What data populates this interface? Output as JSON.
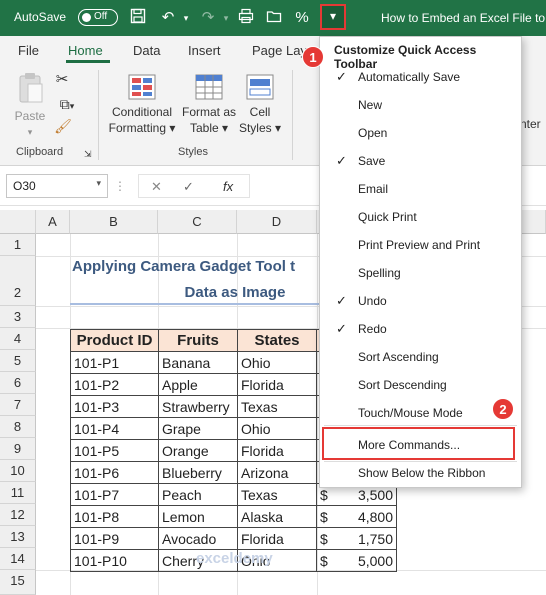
{
  "titlebar": {
    "autosave_label": "AutoSave",
    "autosave_state": "Off",
    "doc_title": "How to Embed an Excel File to I"
  },
  "tabs": [
    "File",
    "Home",
    "Data",
    "Insert",
    "Page Lay"
  ],
  "ribbon": {
    "clipboard": {
      "paste": "Paste",
      "group": "Clipboard"
    },
    "styles": {
      "conditional": [
        "Conditional",
        "Formatting ▾"
      ],
      "format_table": [
        "Format as",
        "Table ▾"
      ],
      "cell_styles": [
        "Cell",
        "Styles ▾"
      ],
      "group": "Styles"
    },
    "partial_right": "nter"
  },
  "formula_bar": {
    "name_box": "O30",
    "fx": "fx"
  },
  "columns": [
    "A",
    "B",
    "C",
    "D"
  ],
  "rows": [
    "1",
    "2",
    "3",
    "4",
    "5",
    "6",
    "7",
    "8",
    "9",
    "10",
    "11",
    "12",
    "13",
    "14",
    "15"
  ],
  "sheet": {
    "title_line1": "Applying Camera Gadget Tool t",
    "title_line2": "Data as Image",
    "headers": [
      "Product ID",
      "Fruits",
      "States"
    ],
    "table": [
      {
        "id": "101-P1",
        "fruit": "Banana",
        "state": "Ohio",
        "amount": ""
      },
      {
        "id": "101-P2",
        "fruit": "Apple",
        "state": "Florida",
        "amount": ""
      },
      {
        "id": "101-P3",
        "fruit": "Strawberry",
        "state": "Texas",
        "amount": ""
      },
      {
        "id": "101-P4",
        "fruit": "Grape",
        "state": "Ohio",
        "amount": ""
      },
      {
        "id": "101-P5",
        "fruit": "Orange",
        "state": "Florida",
        "amount": ""
      },
      {
        "id": "101-P6",
        "fruit": "Blueberry",
        "state": "Arizona",
        "amount": ""
      },
      {
        "id": "101-P7",
        "fruit": "Peach",
        "state": "Texas",
        "amount": "3,500"
      },
      {
        "id": "101-P8",
        "fruit": "Lemon",
        "state": "Alaska",
        "amount": "4,800"
      },
      {
        "id": "101-P9",
        "fruit": "Avocado",
        "state": "Florida",
        "amount": "1,750"
      },
      {
        "id": "101-P10",
        "fruit": "Cherry",
        "state": "Ohio",
        "amount": "5,000"
      }
    ],
    "currency": "$",
    "watermark": "exceldemy"
  },
  "menu": {
    "title": "Customize Quick Access Toolbar",
    "items": [
      {
        "label": "Automatically Save",
        "checked": true
      },
      {
        "label": "New",
        "checked": false
      },
      {
        "label": "Open",
        "checked": false
      },
      {
        "label": "Save",
        "checked": true
      },
      {
        "label": "Email",
        "checked": false
      },
      {
        "label": "Quick Print",
        "checked": false
      },
      {
        "label": "Print Preview and Print",
        "checked": false
      },
      {
        "label": "Spelling",
        "checked": false
      },
      {
        "label": "Undo",
        "checked": true
      },
      {
        "label": "Redo",
        "checked": true
      },
      {
        "label": "Sort Ascending",
        "checked": false
      },
      {
        "label": "Sort Descending",
        "checked": false
      },
      {
        "label": "Touch/Mouse Mode",
        "checked": false
      }
    ],
    "more_commands": "More Commands...",
    "show_below": "Show Below the Ribbon"
  },
  "badges": [
    "1",
    "2"
  ],
  "colors": {
    "excel_green": "#217346",
    "highlight_red": "#e53935",
    "header_fill": "#fbe4d5"
  }
}
